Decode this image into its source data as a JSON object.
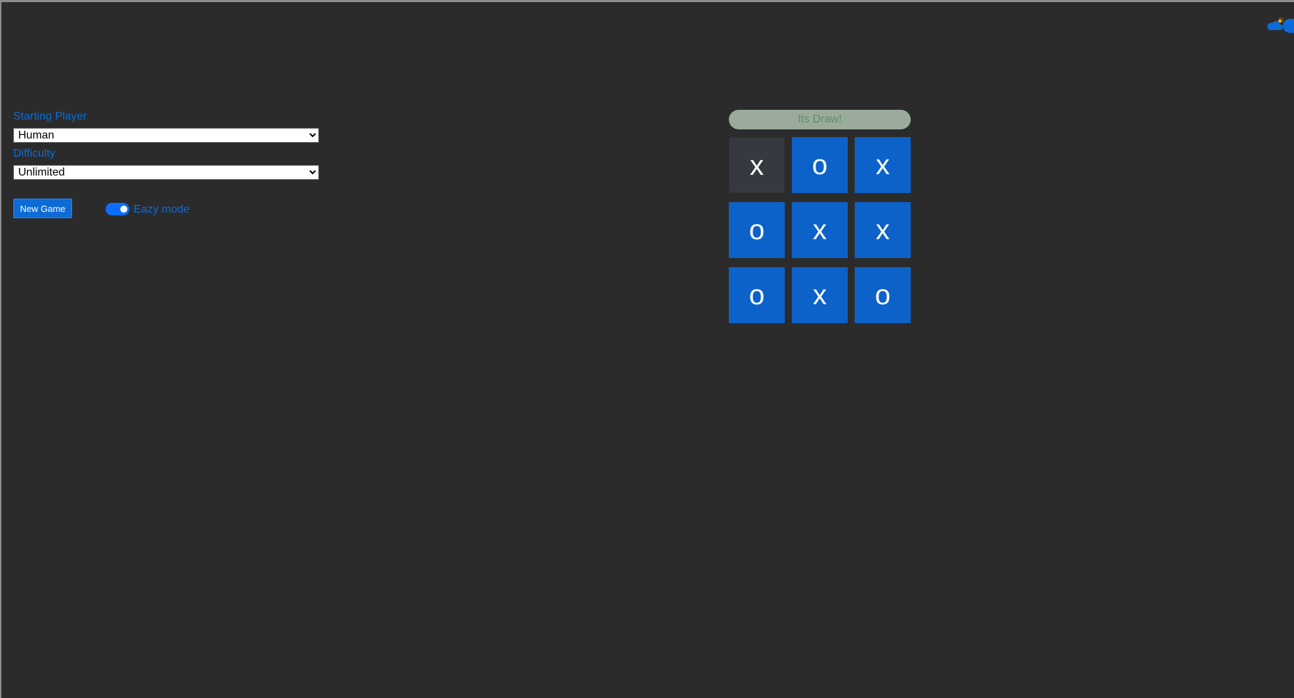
{
  "theme_toggle": {
    "icons": [
      "cloud-icon",
      "sun-icon"
    ],
    "colors": {
      "cloud": "#0c6bd6",
      "sun": "#f2b705",
      "track": "#0c6bd6"
    }
  },
  "settings": {
    "starting_player": {
      "label": "Starting Player",
      "selected": "Human"
    },
    "difficulty": {
      "label": "Difficulty",
      "selected": "Unlimited"
    },
    "new_game_label": "New Game",
    "easy_mode": {
      "label": "Eazy mode",
      "checked": true
    }
  },
  "game": {
    "status": "Its Draw!",
    "board": [
      [
        "x",
        "o",
        "x"
      ],
      [
        "o",
        "x",
        "x"
      ],
      [
        "o",
        "x",
        "o"
      ]
    ],
    "highlighted_cell": "0.0"
  },
  "colors": {
    "background": "#2b2b2b",
    "accent": "#0c6bd6",
    "cell": "#0c62c9",
    "cell_highlight": "#363a40",
    "status_bg": "#9aab9c",
    "status_text": "#5d8f66"
  }
}
